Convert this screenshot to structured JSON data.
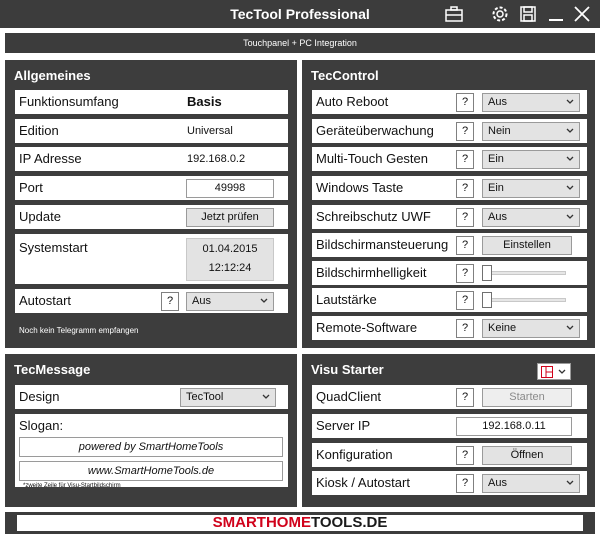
{
  "window": {
    "title": "TecTool Professional"
  },
  "subtitle": "Touchpanel + PC Integration",
  "allgemeines": {
    "title": "Allgemeines",
    "funktionsumfang": {
      "label": "Funktionsumfang",
      "value": "Basis"
    },
    "edition": {
      "label": "Edition",
      "value": "Universal"
    },
    "ip": {
      "label": "IP Adresse",
      "value": "192.168.0.2"
    },
    "port": {
      "label": "Port",
      "value": "49998"
    },
    "update": {
      "label": "Update",
      "button": "Jetzt prüfen"
    },
    "systemstart": {
      "label": "Systemstart",
      "date": "01.04.2015",
      "time": "12:12:24"
    },
    "autostart": {
      "label": "Autostart",
      "help": "?",
      "value": "Aus"
    },
    "status": "Noch kein Telegramm empfangen"
  },
  "teccontrol": {
    "title": "TecControl",
    "rows": [
      {
        "label": "Auto Reboot",
        "help": "?",
        "value": "Aus"
      },
      {
        "label": "Geräteüberwachung",
        "help": "?",
        "value": "Nein"
      },
      {
        "label": "Multi-Touch Gesten",
        "help": "?",
        "value": "Ein"
      },
      {
        "label": "Windows Taste",
        "help": "?",
        "value": "Ein"
      },
      {
        "label": "Schreibschutz UWF",
        "help": "?",
        "value": "Aus"
      },
      {
        "label": "Bildschirmansteuerung",
        "help": "?",
        "button": "Einstellen"
      },
      {
        "label": "Bildschirmhelligkeit",
        "help": "?",
        "slider": 0
      },
      {
        "label": "Lautstärke",
        "help": "?",
        "slider": 0
      },
      {
        "label": "Remote-Software",
        "help": "?",
        "value": "Keine"
      }
    ]
  },
  "tecmessage": {
    "title": "TecMessage",
    "design": {
      "label": "Design",
      "value": "TecTool"
    },
    "slogan": {
      "label": "Slogan:",
      "line1": "powered by SmartHomeTools",
      "line2": "www.SmartHomeTools.de"
    },
    "note": "*zweite Zeile für Visu-Startbildschirm"
  },
  "visustarter": {
    "title": "Visu Starter",
    "quadclient": {
      "label": "QuadClient",
      "help": "?",
      "button": "Starten"
    },
    "serverip": {
      "label": "Server IP",
      "value": "192.168.0.11"
    },
    "konfiguration": {
      "label": "Konfiguration",
      "help": "?",
      "button": "Öffnen"
    },
    "kiosk": {
      "label": "Kiosk / Autostart",
      "help": "?",
      "value": "Aus"
    }
  },
  "footer": {
    "logo_part1": "SMARTHOME",
    "logo_part2": "TOOLS.DE"
  },
  "colors": {
    "panel": "#3d3d3d",
    "accent_red": "#d0021b",
    "titlebar": "#3c3c3c"
  }
}
